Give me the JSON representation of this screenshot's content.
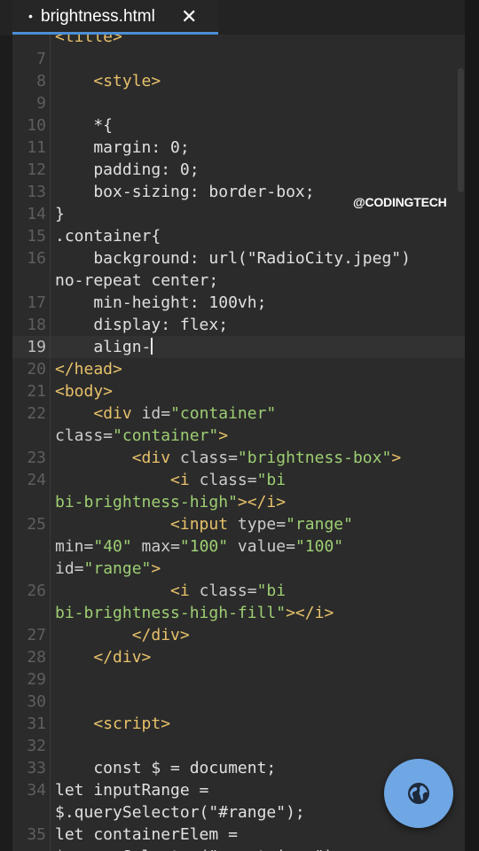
{
  "tab": {
    "modified_marker": "•",
    "filename": "brightness.html",
    "close_glyph": "✕"
  },
  "watermark": "@CODINGTECH",
  "editor": {
    "active_line": "19",
    "lines": [
      {
        "ln": "",
        "parts": [
          [
            "tag",
            "<title>"
          ]
        ],
        "partial": true
      },
      {
        "ln": "7",
        "parts": []
      },
      {
        "ln": "8",
        "parts": [
          [
            "plain",
            "    "
          ],
          [
            "tag",
            "<style>"
          ]
        ]
      },
      {
        "ln": "9",
        "parts": []
      },
      {
        "ln": "10",
        "parts": [
          [
            "plain",
            "    *{"
          ]
        ]
      },
      {
        "ln": "11",
        "parts": [
          [
            "plain",
            "    margin: 0;"
          ]
        ]
      },
      {
        "ln": "12",
        "parts": [
          [
            "plain",
            "    padding: 0;"
          ]
        ]
      },
      {
        "ln": "13",
        "parts": [
          [
            "plain",
            "    box-sizing: border-box;"
          ]
        ]
      },
      {
        "ln": "14",
        "parts": [
          [
            "plain",
            "}"
          ]
        ]
      },
      {
        "ln": "15",
        "parts": [
          [
            "plain",
            ".container{"
          ]
        ]
      },
      {
        "ln": "16",
        "parts": [
          [
            "plain",
            "    background: url(\"RadioCity.jpeg\")"
          ]
        ]
      },
      {
        "ln": "",
        "parts": [
          [
            "plain",
            "no-repeat center;"
          ]
        ]
      },
      {
        "ln": "17",
        "parts": [
          [
            "plain",
            "    min-height: 100vh;"
          ]
        ]
      },
      {
        "ln": "18",
        "parts": [
          [
            "plain",
            "    display: flex;"
          ]
        ]
      },
      {
        "ln": "19",
        "parts": [
          [
            "plain",
            "    align-"
          ]
        ],
        "cursor": true
      },
      {
        "ln": "20",
        "parts": [
          [
            "tag",
            "</head>"
          ]
        ]
      },
      {
        "ln": "21",
        "parts": [
          [
            "tag",
            "<body>"
          ]
        ]
      },
      {
        "ln": "22",
        "parts": [
          [
            "plain",
            "    "
          ],
          [
            "tag",
            "<div "
          ],
          [
            "attr",
            "id="
          ],
          [
            "str",
            "\"container\""
          ]
        ]
      },
      {
        "ln": "",
        "parts": [
          [
            "attr",
            "class="
          ],
          [
            "str",
            "\"container\""
          ],
          [
            "tag",
            ">"
          ]
        ]
      },
      {
        "ln": "23",
        "parts": [
          [
            "plain",
            "        "
          ],
          [
            "tag",
            "<div "
          ],
          [
            "attr",
            "class="
          ],
          [
            "str",
            "\"brightness-box\""
          ],
          [
            "tag",
            ">"
          ]
        ]
      },
      {
        "ln": "24",
        "parts": [
          [
            "plain",
            "            "
          ],
          [
            "tag",
            "<i "
          ],
          [
            "attr",
            "class="
          ],
          [
            "str",
            "\"bi"
          ]
        ]
      },
      {
        "ln": "",
        "parts": [
          [
            "str",
            "bi-brightness-high\""
          ],
          [
            "tag",
            "></i>"
          ]
        ]
      },
      {
        "ln": "25",
        "parts": [
          [
            "plain",
            "            "
          ],
          [
            "tag",
            "<input "
          ],
          [
            "attr",
            "type="
          ],
          [
            "str",
            "\"range\""
          ]
        ]
      },
      {
        "ln": "",
        "parts": [
          [
            "attr",
            "min="
          ],
          [
            "str",
            "\"40\""
          ],
          [
            "attr",
            " max="
          ],
          [
            "str",
            "\"100\""
          ],
          [
            "attr",
            " value="
          ],
          [
            "str",
            "\"100\""
          ]
        ]
      },
      {
        "ln": "",
        "parts": [
          [
            "attr",
            "id="
          ],
          [
            "str",
            "\"range\""
          ],
          [
            "tag",
            ">"
          ]
        ]
      },
      {
        "ln": "26",
        "parts": [
          [
            "plain",
            "            "
          ],
          [
            "tag",
            "<i "
          ],
          [
            "attr",
            "class="
          ],
          [
            "str",
            "\"bi"
          ]
        ]
      },
      {
        "ln": "",
        "parts": [
          [
            "str",
            "bi-brightness-high-fill\""
          ],
          [
            "tag",
            "></i>"
          ]
        ]
      },
      {
        "ln": "27",
        "parts": [
          [
            "plain",
            "        "
          ],
          [
            "tag",
            "</div>"
          ]
        ]
      },
      {
        "ln": "28",
        "parts": [
          [
            "plain",
            "    "
          ],
          [
            "tag",
            "</div>"
          ]
        ]
      },
      {
        "ln": "29",
        "parts": []
      },
      {
        "ln": "30",
        "parts": []
      },
      {
        "ln": "31",
        "parts": [
          [
            "plain",
            "    "
          ],
          [
            "tag",
            "<script>"
          ]
        ]
      },
      {
        "ln": "32",
        "parts": []
      },
      {
        "ln": "33",
        "parts": [
          [
            "plain",
            "    const $ = document;"
          ]
        ]
      },
      {
        "ln": "34",
        "parts": [
          [
            "plain",
            "let inputRange ="
          ]
        ]
      },
      {
        "ln": "",
        "parts": [
          [
            "plain",
            "$.querySelector(\"#range\");"
          ]
        ]
      },
      {
        "ln": "35",
        "parts": [
          [
            "plain",
            "let containerElem ="
          ]
        ]
      },
      {
        "ln": "",
        "parts": [
          [
            "plain",
            "$.querySelector(\".container\");"
          ]
        ],
        "partial": true
      }
    ]
  },
  "fab": {
    "icon": "globe-icon"
  }
}
